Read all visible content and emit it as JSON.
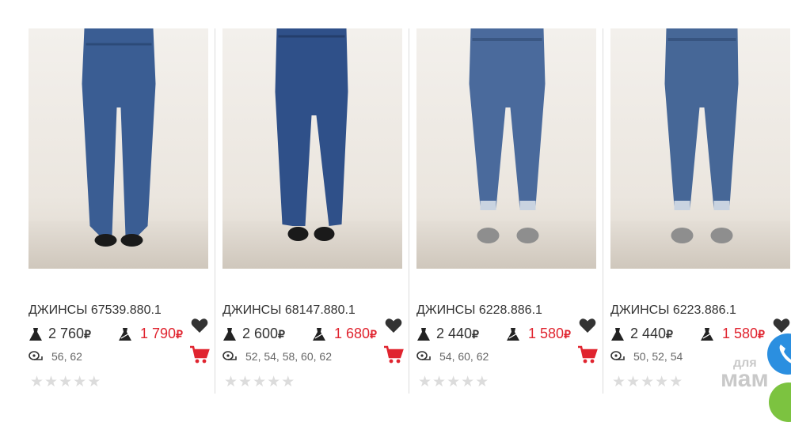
{
  "products": [
    {
      "title": "ДЖИНСЫ 67539.880.1",
      "price_old": "2 760",
      "price_new": "1 790",
      "currency": "₽",
      "sizes": "56, 62",
      "rating_stars": [
        "★",
        "★",
        "★",
        "★",
        "★"
      ],
      "denim_color": "#3a5d93"
    },
    {
      "title": "ДЖИНСЫ 68147.880.1",
      "price_old": "2 600",
      "price_new": "1 680",
      "currency": "₽",
      "sizes": "52, 54, 58, 60, 62",
      "rating_stars": [
        "★",
        "★",
        "★",
        "★",
        "★"
      ],
      "denim_color": "#2f5089"
    },
    {
      "title": "ДЖИНСЫ 6228.886.1",
      "price_old": "2 440",
      "price_new": "1 580",
      "currency": "₽",
      "sizes": "54, 60, 62",
      "rating_stars": [
        "★",
        "★",
        "★",
        "★",
        "★"
      ],
      "denim_color": "#4a6a9c"
    },
    {
      "title": "ДЖИНСЫ 6223.886.1",
      "price_old": "2 440",
      "price_new": "1 580",
      "currency": "₽",
      "sizes": "50, 52, 54",
      "rating_stars": [
        "★",
        "★",
        "★",
        "★",
        "★"
      ],
      "denim_color": "#466797"
    }
  ],
  "icons": {
    "heart": "heart-icon",
    "cart": "cart-icon",
    "dress": "dress-icon",
    "size": "size-tape-icon",
    "star": "star-icon",
    "phone": "phone-icon"
  },
  "colors": {
    "sale_price": "#e0242f",
    "cart_icon": "#e0242f",
    "heart_icon": "#333333",
    "star_inactive": "#dcdcdc",
    "phone_button": "#2b8fe0",
    "chat_button": "#7cc340"
  },
  "watermark": {
    "line1": "для",
    "line2": "мам"
  }
}
